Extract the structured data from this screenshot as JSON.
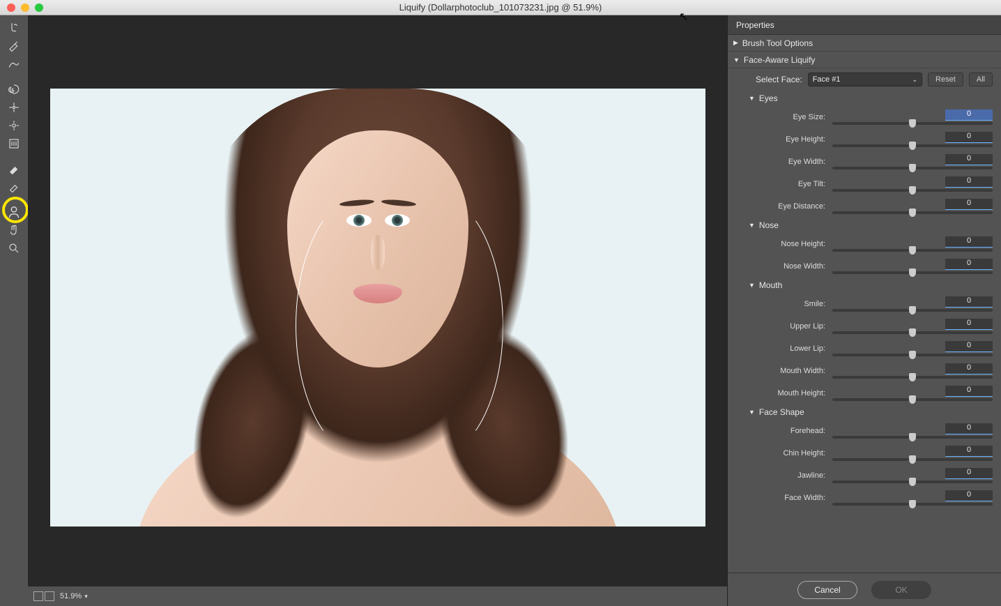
{
  "window": {
    "title": "Liquify (Dollarphotoclub_101073231.jpg @ 51.9%)"
  },
  "toolbar_tools": [
    {
      "name": "forward-warp",
      "icon": "finger"
    },
    {
      "name": "reconstruct",
      "icon": "brush"
    },
    {
      "name": "smooth",
      "icon": "smooth"
    },
    {
      "name": "twirl",
      "icon": "swirl"
    },
    {
      "name": "pucker",
      "icon": "pucker"
    },
    {
      "name": "bloat",
      "icon": "bloat"
    },
    {
      "name": "push-left",
      "icon": "push"
    },
    {
      "name": "freeze-mask",
      "icon": "freeze"
    },
    {
      "name": "thaw-mask",
      "icon": "thaw"
    },
    {
      "name": "face-tool",
      "icon": "face"
    },
    {
      "name": "hand",
      "icon": "hand"
    },
    {
      "name": "zoom",
      "icon": "zoom"
    }
  ],
  "zoom": {
    "percent": "51.9%"
  },
  "panel": {
    "title": "Properties",
    "sections": {
      "brush_options": {
        "label": "Brush Tool Options",
        "expanded": false
      },
      "face_aware": {
        "label": "Face-Aware Liquify",
        "select_face_label": "Select Face:",
        "selected_face": "Face #1",
        "reset": "Reset",
        "all": "All",
        "groups": {
          "eyes": {
            "label": "Eyes",
            "sliders": [
              {
                "label": "Eye Size:",
                "value": "0",
                "active": true
              },
              {
                "label": "Eye Height:",
                "value": "0"
              },
              {
                "label": "Eye Width:",
                "value": "0"
              },
              {
                "label": "Eye Tilt:",
                "value": "0"
              },
              {
                "label": "Eye Distance:",
                "value": "0"
              }
            ]
          },
          "nose": {
            "label": "Nose",
            "sliders": [
              {
                "label": "Nose Height:",
                "value": "0"
              },
              {
                "label": "Nose Width:",
                "value": "0"
              }
            ]
          },
          "mouth": {
            "label": "Mouth",
            "sliders": [
              {
                "label": "Smile:",
                "value": "0"
              },
              {
                "label": "Upper Lip:",
                "value": "0"
              },
              {
                "label": "Lower Lip:",
                "value": "0"
              },
              {
                "label": "Mouth Width:",
                "value": "0"
              },
              {
                "label": "Mouth Height:",
                "value": "0"
              }
            ]
          },
          "face_shape": {
            "label": "Face Shape",
            "sliders": [
              {
                "label": "Forehead:",
                "value": "0"
              },
              {
                "label": "Chin Height:",
                "value": "0"
              },
              {
                "label": "Jawline:",
                "value": "0"
              },
              {
                "label": "Face Width:",
                "value": "0"
              }
            ]
          }
        }
      }
    },
    "footer": {
      "cancel": "Cancel",
      "ok": "OK"
    }
  }
}
